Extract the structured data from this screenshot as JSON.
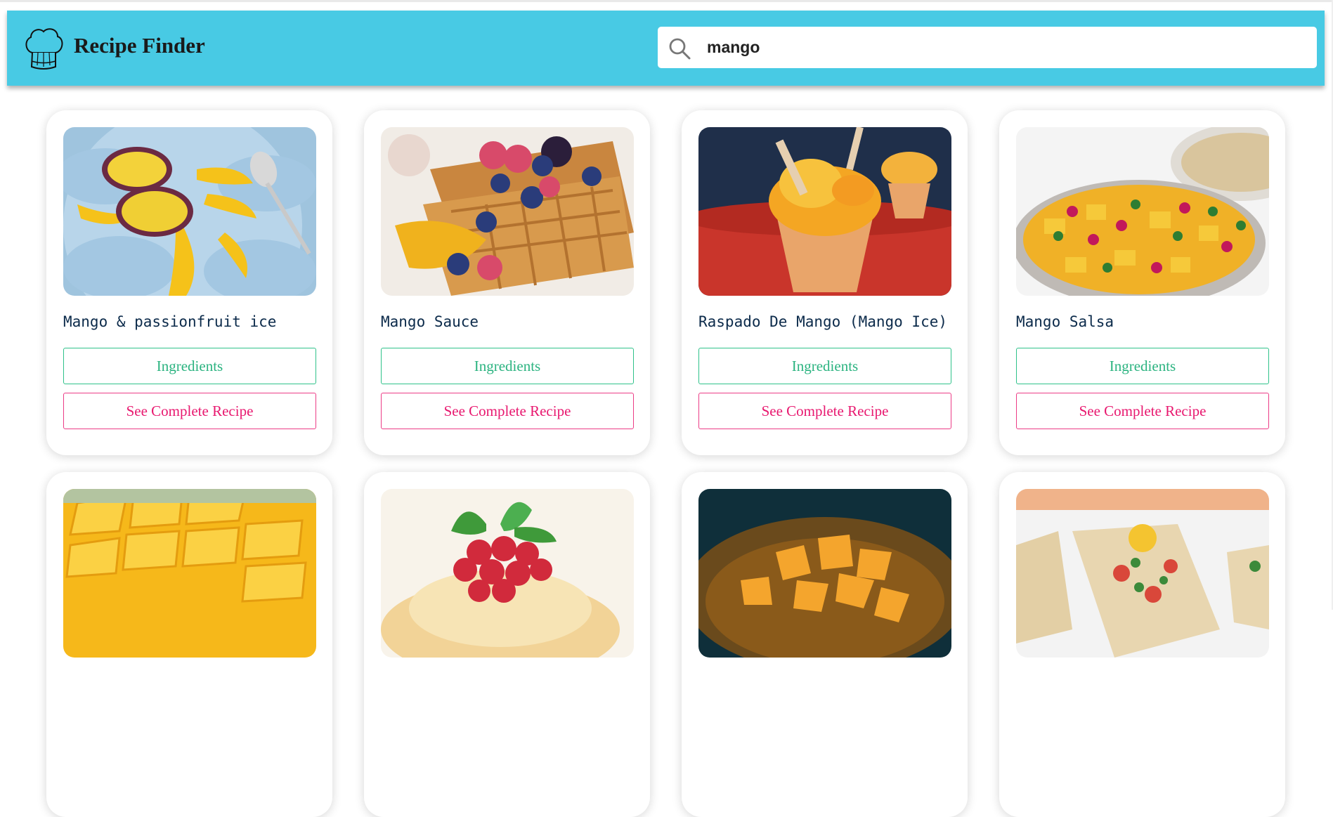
{
  "app": {
    "title": "Recipe Finder",
    "logo_icon": "chef-hat-icon"
  },
  "search": {
    "value": "mango",
    "icon": "search-icon"
  },
  "colors": {
    "header": "#48cae4",
    "ingredients": "#2bb380",
    "recipe": "#e8186f",
    "title_text": "#0b2a4a"
  },
  "recipes": [
    {
      "name": "Mango & passionfruit ice",
      "ingredients_label": "Ingredients",
      "recipe_label": "See Complete Recipe"
    },
    {
      "name": "Mango Sauce",
      "ingredients_label": "Ingredients",
      "recipe_label": "See Complete Recipe"
    },
    {
      "name": "Raspado De Mango (Mango Ice)",
      "ingredients_label": "Ingredients",
      "recipe_label": "See Complete Recipe"
    },
    {
      "name": "Mango Salsa",
      "ingredients_label": "Ingredients",
      "recipe_label": "See Complete Recipe"
    },
    {
      "name": "",
      "ingredients_label": "",
      "recipe_label": ""
    },
    {
      "name": "",
      "ingredients_label": "",
      "recipe_label": ""
    },
    {
      "name": "",
      "ingredients_label": "",
      "recipe_label": ""
    },
    {
      "name": "",
      "ingredients_label": "",
      "recipe_label": ""
    }
  ]
}
